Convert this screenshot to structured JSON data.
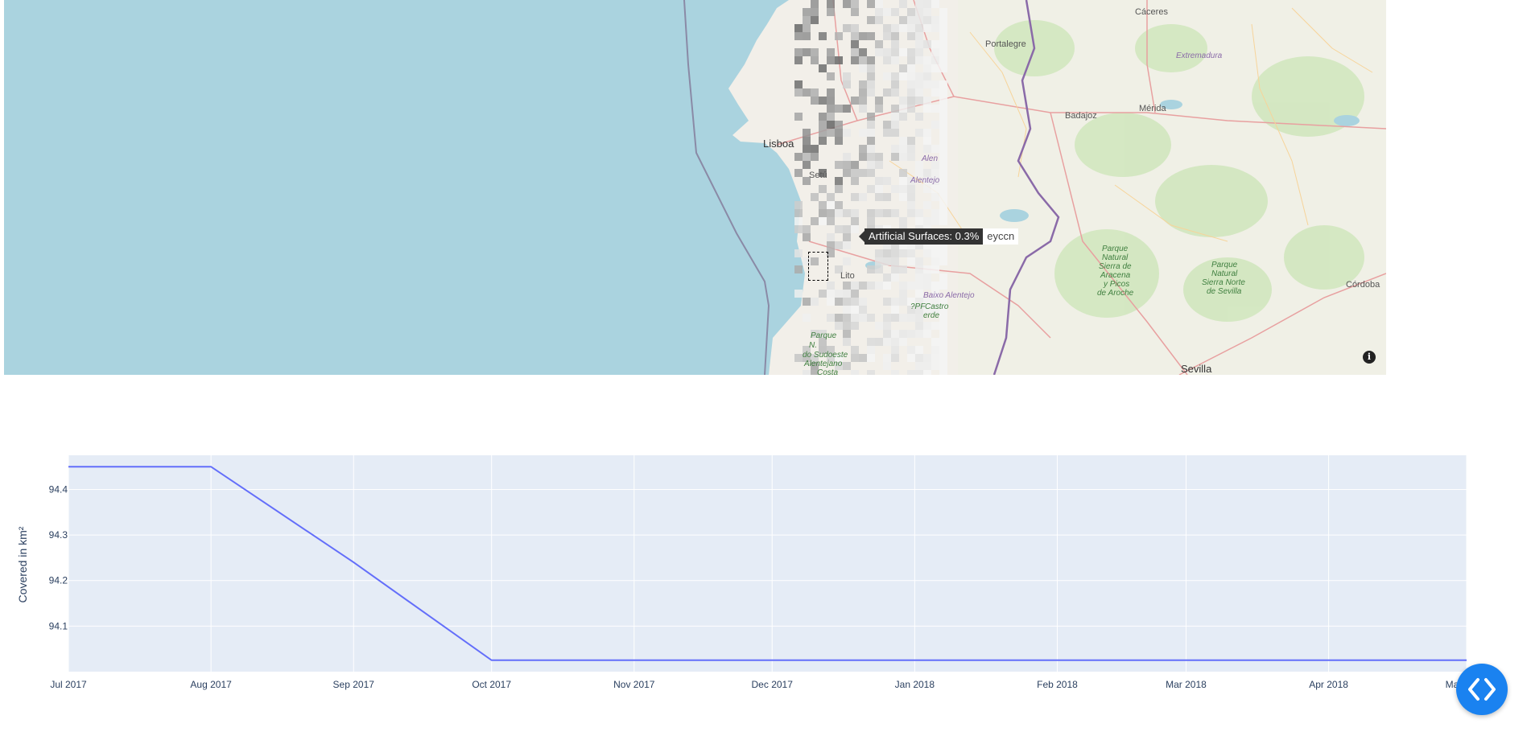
{
  "map": {
    "places": {
      "lisboa": "Lisboa",
      "portalegre": "Portalegre",
      "caceres": "Cáceres",
      "extremadura": "Extremadura",
      "merida": "Mérida",
      "badajoz": "Badajoz",
      "alentejo": "Alentejo",
      "alentejo_upper": "Alen",
      "baixo_alentejo": "Baixo Alentejo",
      "castro": "Castro",
      "castro_2": "erde",
      "litoral": "Lito",
      "sudoeste_1": "Parque",
      "sudoeste_2": "N.",
      "sudoeste_3": "do Sudoeste",
      "sudoeste_4": "Alentejano",
      "sudoeste_5": "Costa",
      "aracena_1": "Parque",
      "aracena_2": "Natural",
      "aracena_3": "Sierra de",
      "aracena_4": "Aracena",
      "aracena_5": "y Picos",
      "aracena_6": "de Aroche",
      "sierra_norte_1": "Parque",
      "sierra_norte_2": "Natural",
      "sierra_norte_3": "Sierra Norte",
      "sierra_norte_4": "de Sevilla",
      "cordoba": "Córdoba",
      "sevilla": "Sevilla",
      "road_279": "?PF",
      "setubal": "Setú"
    },
    "tooltip": {
      "text": "Artificial Surfaces: 0.3%",
      "name": "eyccn"
    },
    "info_icon": "i",
    "colors": {
      "sea": "#aad3df",
      "land": "#f2efe9",
      "coast": "#8a8aa6"
    }
  },
  "chart_data": {
    "type": "line",
    "x": [
      "2017-07-01",
      "2017-08-01",
      "2017-09-01",
      "2017-10-01",
      "2017-11-01",
      "2017-12-01",
      "2018-01-01",
      "2018-02-01",
      "2018-03-01",
      "2018-04-01",
      "2018-05-01"
    ],
    "series": [
      {
        "values": [
          94.45,
          94.45,
          94.24,
          94.025,
          94.025,
          94.025,
          94.025,
          94.025,
          94.025,
          94.025,
          94.025
        ],
        "color": "#636efa"
      }
    ],
    "ylabel": "Covered in km²",
    "xlabel": "",
    "yticks": [
      94.1,
      94.2,
      94.3,
      94.4
    ],
    "ytick_labels": [
      "94.1",
      "94.2",
      "94.3",
      "94.4"
    ],
    "xtick_labels": [
      "Jul 2017",
      "Aug 2017",
      "Sep 2017",
      "Oct 2017",
      "Nov 2017",
      "Dec 2017",
      "Jan 2018",
      "Feb 2018",
      "Mar 2018",
      "Apr 2018",
      "May 2018"
    ],
    "ylim": [
      94.0,
      94.475
    ],
    "grid": true,
    "plot_bgcolor": "#e5ecf6"
  },
  "fab": {
    "icon": "code-icon"
  }
}
